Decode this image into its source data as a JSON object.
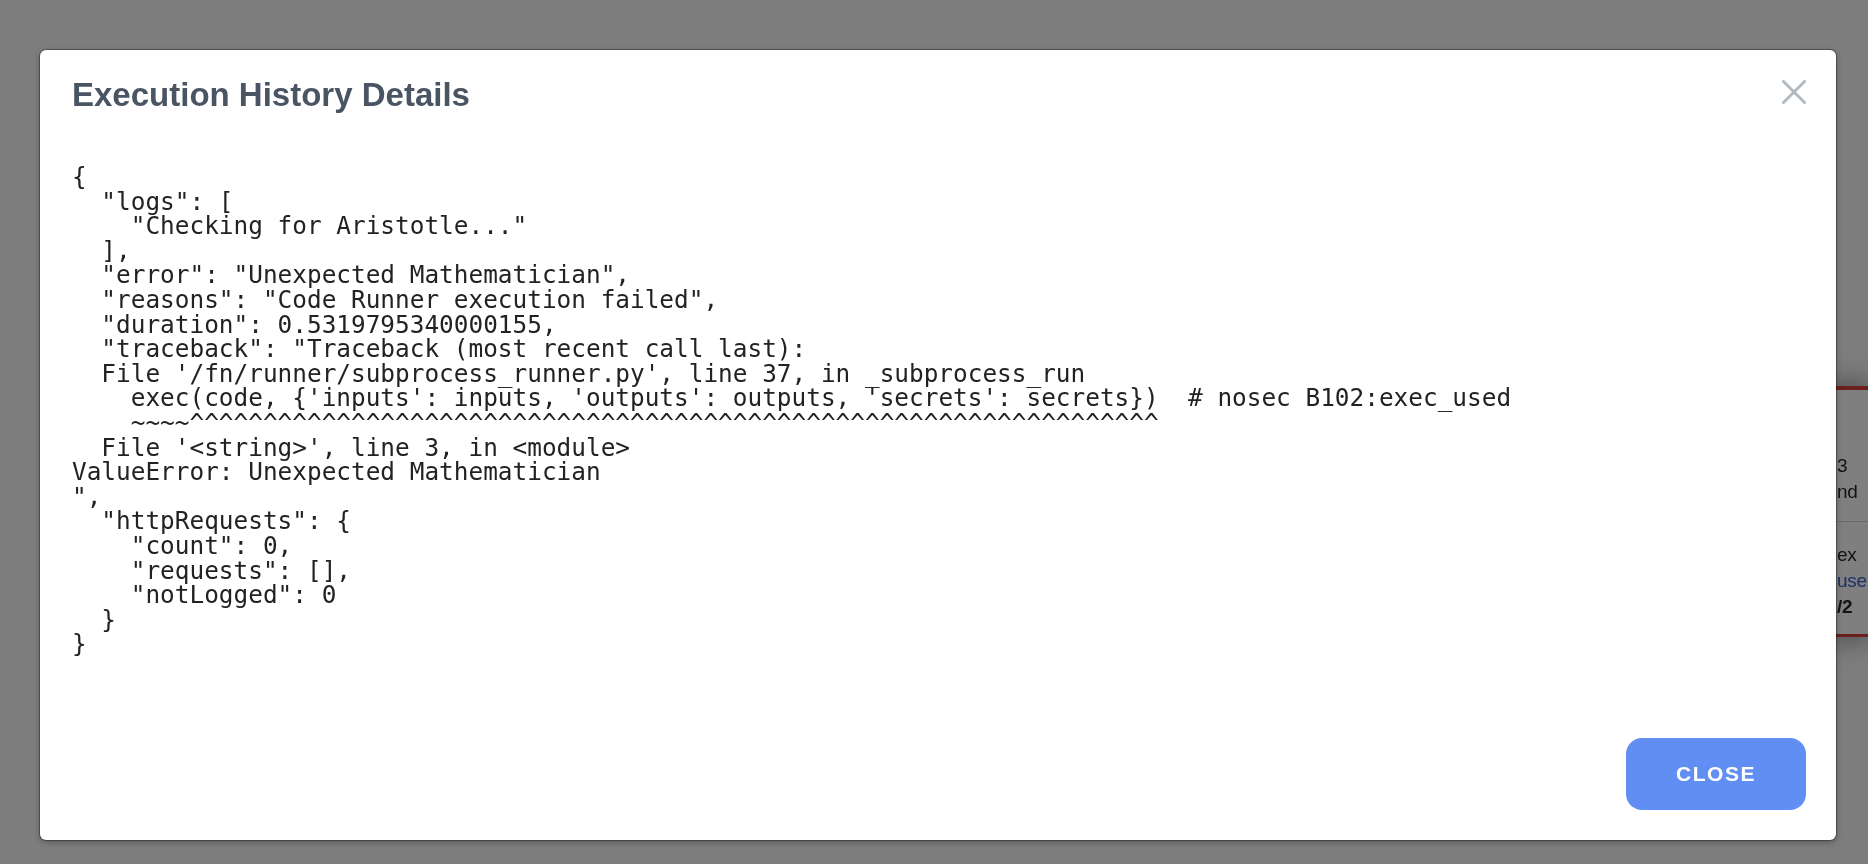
{
  "background_card": {
    "sections": [
      {
        "lines": [
          {
            "text": "3",
            "kind": "text"
          },
          {
            "text": "nd",
            "kind": "text"
          }
        ]
      },
      {
        "lines": [
          {
            "text": "ex",
            "kind": "text"
          },
          {
            "text": "use",
            "kind": "link"
          },
          {
            "text": "/2",
            "kind": "bold"
          }
        ]
      }
    ]
  },
  "modal": {
    "title": "Execution History Details",
    "details_lines": [
      "{",
      "  \"logs\": [",
      "    \"Checking for Aristotle...\"",
      "  ],",
      "  \"error\": \"Unexpected Mathematician\",",
      "  \"reasons\": \"Code Runner execution failed\",",
      "  \"duration\": 0.5319795340000155,",
      "  \"traceback\": \"Traceback (most recent call last):",
      "  File '/fn/runner/subprocess_runner.py', line 37, in _subprocess_run",
      "    exec(code, {'inputs': inputs, 'outputs': outputs, 'secrets': secrets})  # nosec B102:exec_used",
      "    ~~~~^^^^^^^^^^^^^^^^^^^^^^^^^^^^^^^^^^^^^^^^^^^^^^^^^^^^^^^^^^^^^^^^^^",
      "  File '<string>', line 3, in <module>",
      "ValueError: Unexpected Mathematician",
      "\",",
      "  \"httpRequests\": {",
      "    \"count\": 0,",
      "    \"requests\": [],",
      "    \"notLogged\": 0",
      "  }",
      "}"
    ],
    "buttons": [
      "CLOSE"
    ]
  }
}
